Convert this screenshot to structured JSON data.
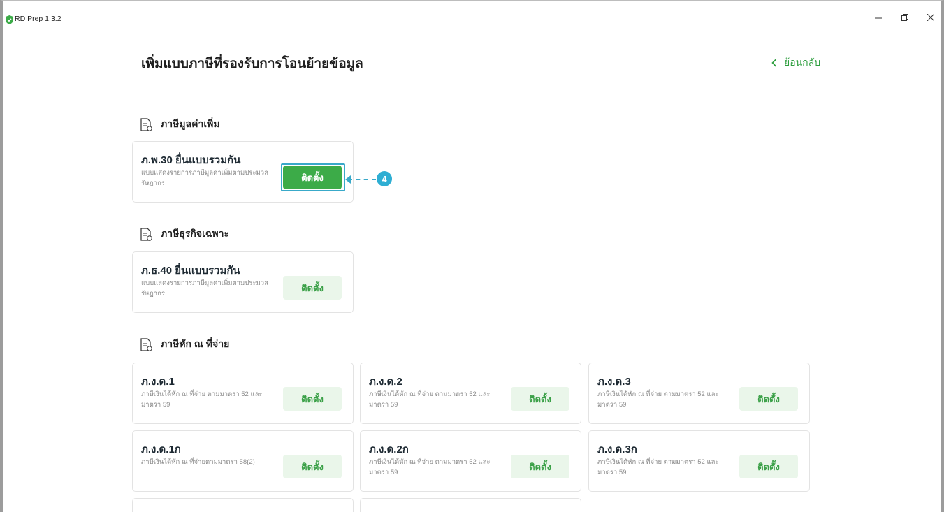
{
  "window": {
    "title": "RD Prep 1.3.2",
    "minimize_icon": "minimize-icon",
    "restore_icon": "restore-icon",
    "close_icon": "close-icon"
  },
  "header": {
    "title": "เพิ่มแบบภาษีที่รองรับการโอนย้ายข้อมูล",
    "back_label": "ย้อนกลับ"
  },
  "colors": {
    "accent": "#3cab48",
    "install_bg": "#eaf6ea",
    "annotation": "#2eaed3"
  },
  "sections": [
    {
      "title": "ภาษีมูลค่าเพิ่ม",
      "icon": "document-icon",
      "cards": [
        {
          "name": "ภ.พ.30 ยื่นแบบรวมกัน",
          "desc": "แบบแสดงรายการภาษีมูลค่าเพิ่มตามประมวลรัษฎากร",
          "button": "ติดตั้ง",
          "highlighted": true
        }
      ]
    },
    {
      "title": "ภาษีธุรกิจเฉพาะ",
      "icon": "document-icon",
      "cards": [
        {
          "name": "ภ.ธ.40 ยื่นแบบรวมกัน",
          "desc": "แบบแสดงรายการภาษีมูลค่าเพิ่มตามประมวลรัษฎากร",
          "button": "ติดตั้ง"
        }
      ]
    },
    {
      "title": "ภาษีหัก ณ ที่จ่าย",
      "icon": "document-icon",
      "cards": [
        {
          "name": "ภ.ง.ด.1",
          "desc": "ภาษีเงินได้หัก ณ ที่จ่าย ตามมาตรา 52 และมาตรา 59",
          "button": "ติดตั้ง"
        },
        {
          "name": "ภ.ง.ด.2",
          "desc": "ภาษีเงินได้หัก ณ ที่จ่าย ตามมาตรา 52 และมาตรา 59",
          "button": "ติดตั้ง"
        },
        {
          "name": "ภ.ง.ด.3",
          "desc": "ภาษีเงินได้หัก ณ ที่จ่าย ตามมาตรา 52 และมาตรา 59",
          "button": "ติดตั้ง"
        },
        {
          "name": "ภ.ง.ด.1ก",
          "desc": "ภาษีเงินได้หัก ณ ที่จ่ายตามมาตรา 58(2)",
          "button": "ติดตั้ง"
        },
        {
          "name": "ภ.ง.ด.2ก",
          "desc": "ภาษีเงินได้หัก ณ ที่จ่าย ตามมาตรา 52 และมาตรา 59",
          "button": "ติดตั้ง"
        },
        {
          "name": "ภ.ง.ด.3ก",
          "desc": "ภาษีเงินได้หัก ณ ที่จ่าย ตามมาตรา 52 และมาตรา 59",
          "button": "ติดตั้ง"
        }
      ]
    }
  ],
  "annotation": {
    "step": "4"
  }
}
